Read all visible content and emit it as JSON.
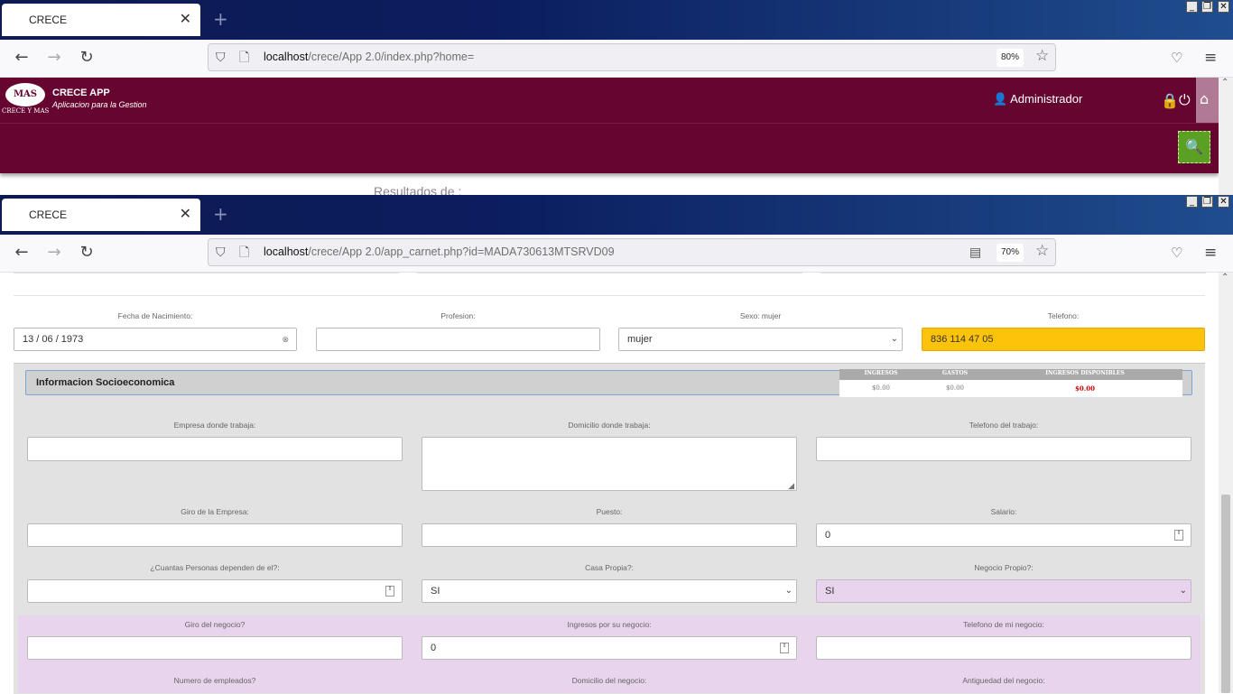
{
  "window1": {
    "tab_title": "CRECE",
    "url_host": "localhost",
    "url_path": "/crece/App 2.0/index.php?home=",
    "zoom": "80%",
    "app": {
      "logo_text": "MAS",
      "logo_sub": "CRECE Y MAS",
      "name": "CRECE APP",
      "tagline": "Aplicacion para la Gestion",
      "user": "Administrador"
    },
    "results_text": "Resultados de :"
  },
  "window2": {
    "tab_title": "CRECE",
    "url_host": "localhost",
    "url_path": "/crece/App 2.0/app_carnet.php?id=MADA730613MTSRVD09",
    "zoom": "70%",
    "form": {
      "fecha_label": "Fecha de Nacimiento:",
      "fecha_value": "13 / 06 / 1973",
      "profesion_label": "Profesion:",
      "profesion_value": "",
      "sexo_label": "Sexo: mujer",
      "sexo_value": "mujer",
      "telefono_label": "Telefono:",
      "telefono_value": "836 114 47 05"
    },
    "socio": {
      "title": "Informacion Socioeconomica",
      "summary_headers": [
        "INGRESOS",
        "GASTOS",
        "INGRESOS DISPONIBLES"
      ],
      "summary_values": [
        "$0.00",
        "$0.00",
        "$0.00"
      ],
      "empresa_label": "Empresa donde trabaja:",
      "domicilio_label": "Domicilio donde trabaja:",
      "tel_trabajo_label": "Telefono del trabajo:",
      "giro_label": "Giro de la Empresa:",
      "puesto_label": "Puesto:",
      "salario_label": "Salario:",
      "salario_value": "0",
      "dependen_label": "¿Cuantas Personas dependen de el?:",
      "casa_label": "Casa Propia?:",
      "casa_value": "SI",
      "negocio_label": "Negocio Propio?:",
      "negocio_value": "SI",
      "giro_negocio_label": "Giro del negocio?",
      "ingresos_negocio_label": "Ingresos por su negocio:",
      "ingresos_negocio_value": "0",
      "tel_negocio_label": "Telefono de mi negocio:",
      "empleados_label": "Numero de empleados?",
      "dom_negocio_label": "Domicilio del negocio:",
      "antiguedad_label": "Antiguedad del negocio:"
    }
  },
  "colors": {
    "app_header": "#660630",
    "search_button": "#5aa022",
    "telefono_highlight": "#fcc30a",
    "business_section": "#e8d4ec",
    "disponibles_value": "#cc0000"
  }
}
